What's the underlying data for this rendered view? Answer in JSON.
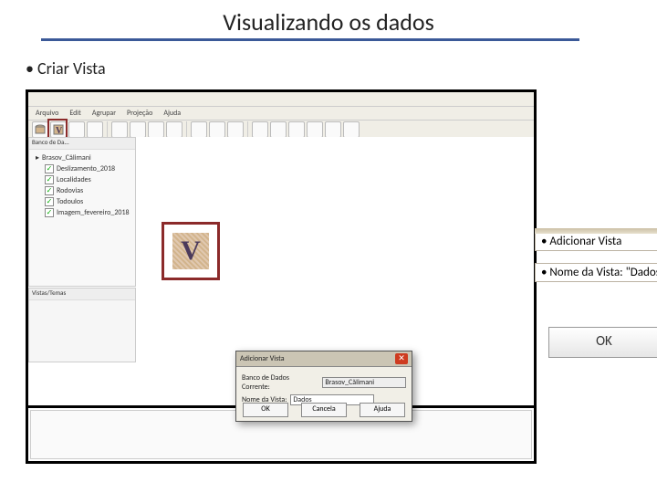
{
  "title": "Visualizando os dados",
  "bullet": "• Criar Vista",
  "menus": [
    "Arquivo",
    "Edit",
    "Agrupar",
    "Projeção",
    "Ajuda"
  ],
  "sidebar": {
    "header": "Banco de Da...",
    "root": "Brasov_Călimani",
    "items": [
      "Deslizamento_2018",
      "Localidades",
      "Rodovias",
      "Todoulos",
      "Imagem_fevereiro_2018"
    ]
  },
  "sidebar2_header": "Vistas/Temas",
  "big_v": "V",
  "dialog": {
    "title": "Adicionar Vista",
    "row1_lbl": "Banco de Dados Corrente:",
    "row1_val": "Brasov_Călimani",
    "row2_lbl": "Nome da Vista:",
    "row2_val": "Dados",
    "ok": "OK",
    "cancel": "Cancela",
    "help": "Ajuda"
  },
  "callouts": {
    "one": "• Adicionar Vista",
    "two": "• Nome da Vista: \"Dados\""
  },
  "ok_main": "OK"
}
